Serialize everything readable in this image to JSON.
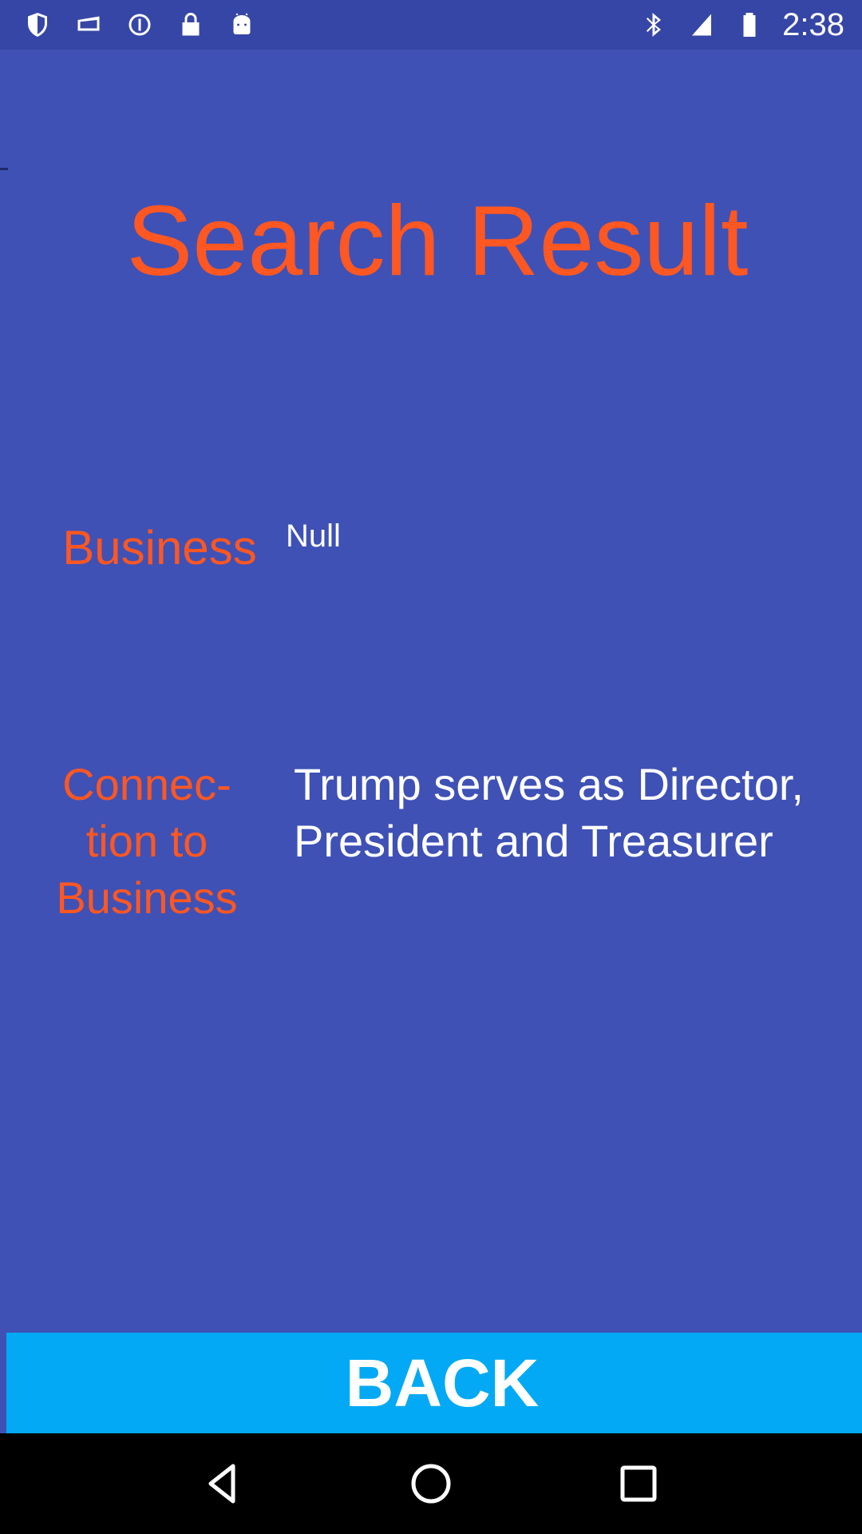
{
  "status_bar": {
    "time": "2:38",
    "left_icons": [
      "shield-icon",
      "mail-icon",
      "info-circle-icon",
      "lock-icon",
      "android-icon"
    ],
    "right_icons": [
      "bluetooth-icon",
      "signal-icon",
      "battery-icon"
    ]
  },
  "page": {
    "title": "Search Result",
    "business_label": "Business",
    "business_value": "Null",
    "connection_label": "Connec-tion to Business",
    "connection_value": "Trump serves as Director, President and Treasurer"
  },
  "actions": {
    "back_label": "BACK"
  },
  "nav_bar": {
    "icons": [
      "back-triangle-icon",
      "home-circle-icon",
      "recents-square-icon"
    ]
  },
  "colors": {
    "background": "#3F51B5",
    "status_bar": "#3646A6",
    "accent_text": "#FF5722",
    "button": "#03A9F4"
  }
}
